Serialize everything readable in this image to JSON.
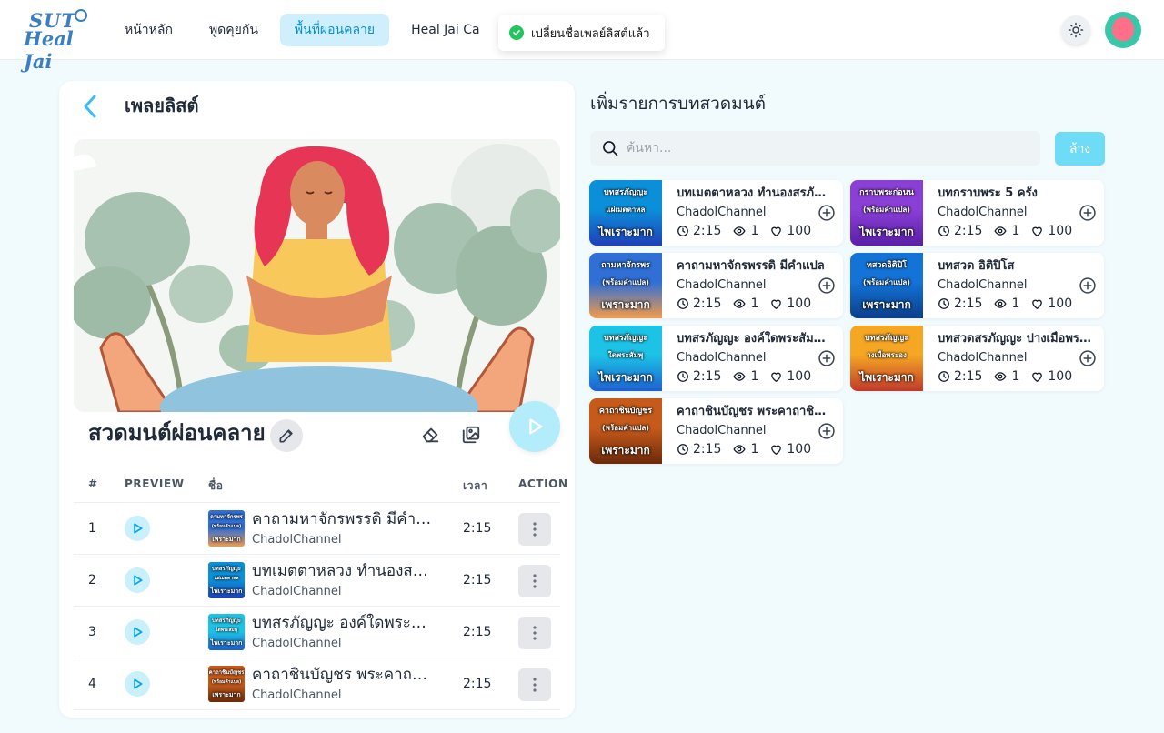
{
  "app": {
    "logo_line1": "SUT",
    "logo_line2": "Heal Jai"
  },
  "nav": [
    {
      "label": "หน้าหลัก",
      "active": false
    },
    {
      "label": "พูดคุยกัน",
      "active": false
    },
    {
      "label": "พื้นที่ผ่อนคลาย",
      "active": true
    },
    {
      "label": "Heal Jai Ca",
      "active": false
    }
  ],
  "toast": {
    "message": "เปลี่ยนชื่อเพลย์ลิสต์แล้ว"
  },
  "playlist": {
    "header": "เพลยลิสต์",
    "name": "สวดมนต์ผ่อนคลาย",
    "columns": {
      "num": "#",
      "preview": "PREVIEW",
      "name": "ชื่อ",
      "time": "เวลา",
      "action": "ACTION"
    },
    "rows": [
      {
        "num": "1",
        "title": "คาถามหาจักรพรรดิ มีคำแปล",
        "channel": "ChadolChannel",
        "duration": "2:15",
        "thumb_text_top": "ถามหาจักรพร",
        "thumb_text_mid": "(พร้อมคำแปล)",
        "thumb_text_bot": "เพราะมาก",
        "thumb_colors": [
          "#2f6fd6",
          "#f29b4a"
        ]
      },
      {
        "num": "2",
        "title": "บทเมตตาหลวง ทำนองสรภัญญะ",
        "channel": "ChadolChannel",
        "duration": "2:15",
        "thumb_text_top": "บทสรภัญญะ",
        "thumb_text_mid": "แผ่เมตตาหล",
        "thumb_text_bot": "ไพเราะมาก",
        "thumb_colors": [
          "#0b8fd9",
          "#1f3fb8"
        ]
      },
      {
        "num": "3",
        "title": "บทสรภัญญะ องค์ใดพระสัมพุทธ",
        "channel": "ChadolChannel",
        "duration": "2:15",
        "thumb_text_top": "บทสรภัญญะ",
        "thumb_text_mid": "ใดพระสัมพุ",
        "thumb_text_bot": "ไพเราะมาก",
        "thumb_colors": [
          "#1cc3e6",
          "#1d5fd0"
        ]
      },
      {
        "num": "4",
        "title": "คาถาชินบัญชร พระคาถาชินบัญชร",
        "channel": "ChadolChannel",
        "duration": "2:15",
        "thumb_text_top": "คาถาชินบัญชร",
        "thumb_text_mid": "(พร้อมคำแปล)",
        "thumb_text_bot": "เพราะมาก",
        "thumb_colors": [
          "#c65a1a",
          "#6b2a0a"
        ]
      }
    ]
  },
  "add_panel": {
    "title": "เพิ่มรายการบทสวดมนต์",
    "search_placeholder": "ค้นหา...",
    "clear_label": "ล้าง",
    "songs": [
      {
        "title": "บทเมตตาหลวง ทำนองสรภัญญะ",
        "channel": "ChadolChannel",
        "duration": "2:15",
        "views": "1",
        "likes": "100",
        "thumb_text_top": "บทสรภัญญะ",
        "thumb_text_mid": "แผ่เมตตาหล",
        "thumb_text_bot": "ไพเราะมาก",
        "thumb_colors": [
          "#0b8fd9",
          "#1f3fb8"
        ]
      },
      {
        "title": "บทกราบพระ 5 ครั้ง",
        "channel": "ChadolChannel",
        "duration": "2:15",
        "views": "1",
        "likes": "100",
        "thumb_text_top": "กราบพระก่อนน",
        "thumb_text_mid": "(พร้อมคำแปล)",
        "thumb_text_bot": "ไพเราะมาก",
        "thumb_colors": [
          "#8a3fd6",
          "#5a1fa8"
        ]
      },
      {
        "title": "คาถามหาจักรพรรดิ มีคำแปล",
        "channel": "ChadolChannel",
        "duration": "2:15",
        "views": "1",
        "likes": "100",
        "thumb_text_top": "ถามหาจักรพร",
        "thumb_text_mid": "(พร้อมคำแปล)",
        "thumb_text_bot": "เพราะมาก",
        "thumb_colors": [
          "#2f6fd6",
          "#f29b4a"
        ]
      },
      {
        "title": "บทสวด อิติปิโส",
        "channel": "ChadolChannel",
        "duration": "2:15",
        "views": "1",
        "likes": "100",
        "thumb_text_top": "ทสวดอิติปิโ",
        "thumb_text_mid": "(พร้อมคำแปล)",
        "thumb_text_bot": "เพราะมาก",
        "thumb_colors": [
          "#1473d6",
          "#0a3f8a"
        ]
      },
      {
        "title": "บทสรภัญญะ องค์ใดพระสัมพุทธ",
        "channel": "ChadolChannel",
        "duration": "2:15",
        "views": "1",
        "likes": "100",
        "thumb_text_top": "บทสรภัญญะ",
        "thumb_text_mid": "ใดพระสัมพุ",
        "thumb_text_bot": "ไพเราะมาก",
        "thumb_colors": [
          "#1cc3e6",
          "#1d5fd0"
        ]
      },
      {
        "title": "บทสวดสรภัญญะ ปางเมื่อพระองค์",
        "channel": "ChadolChannel",
        "duration": "2:15",
        "views": "1",
        "likes": "100",
        "thumb_text_top": "บทสรภัญญะ",
        "thumb_text_mid": "างเมื่อพระอง",
        "thumb_text_bot": "ไพเราะมาก",
        "thumb_colors": [
          "#f5a623",
          "#c0392b"
        ]
      },
      {
        "title": "คาถาชินบัญชร พระคาถาชินบัญชร",
        "channel": "ChadolChannel",
        "duration": "2:15",
        "views": "1",
        "likes": "100",
        "thumb_text_top": "คาถาชินบัญชร",
        "thumb_text_mid": "(พร้อมคำแปล)",
        "thumb_text_bot": "เพราะมาก",
        "thumb_colors": [
          "#c65a1a",
          "#6b2a0a"
        ]
      }
    ]
  }
}
